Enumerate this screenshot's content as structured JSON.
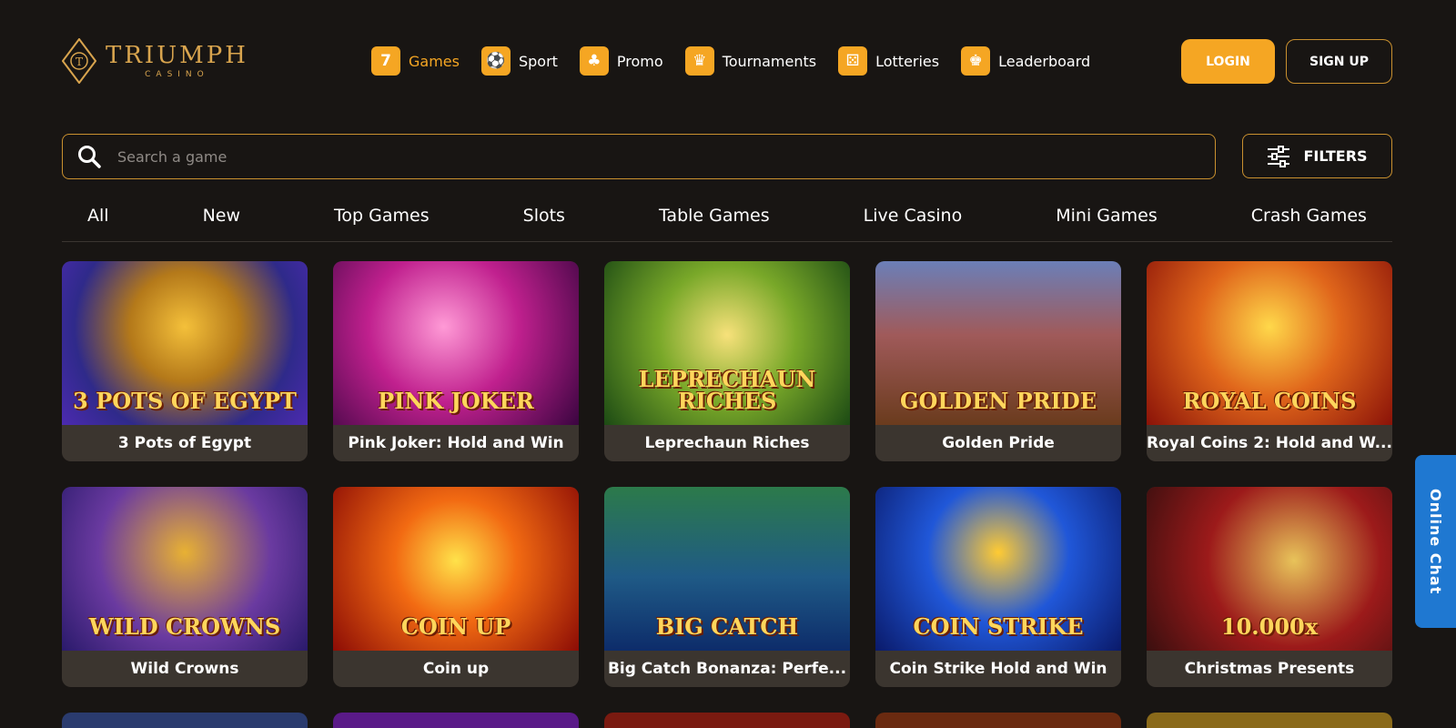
{
  "brand": {
    "name": "TRIUMPH",
    "sub": "CASINO",
    "accent": "#f5a623"
  },
  "nav": [
    {
      "label": "Games",
      "icon": "seven-icon",
      "glyph": "7",
      "active": true
    },
    {
      "label": "Sport",
      "icon": "ball-icon",
      "glyph": "⚽",
      "active": false
    },
    {
      "label": "Promo",
      "icon": "clover-icon",
      "glyph": "♣",
      "active": false
    },
    {
      "label": "Tournaments",
      "icon": "trophy-icon",
      "glyph": "♛",
      "active": false
    },
    {
      "label": "Lotteries",
      "icon": "dice-icon",
      "glyph": "⚄",
      "active": false
    },
    {
      "label": "Leaderboard",
      "icon": "crown-icon",
      "glyph": "♚",
      "active": false
    }
  ],
  "auth": {
    "login": "LOGIN",
    "signup": "SIGN UP"
  },
  "search": {
    "placeholder": "Search a game",
    "value": ""
  },
  "filters": {
    "label": "FILTERS"
  },
  "tabs": [
    "All",
    "New",
    "Top Games",
    "Slots",
    "Table Games",
    "Live Casino",
    "Mini Games",
    "Crash Games"
  ],
  "games": [
    {
      "title": "3 Pots of Egypt",
      "art": "3 POTS OF EGYPT"
    },
    {
      "title": "Pink Joker: Hold and Win",
      "art": "PINK JOKER"
    },
    {
      "title": "Leprechaun Riches",
      "art": "LEPRECHAUN RICHES"
    },
    {
      "title": "Golden Pride",
      "art": "GOLDEN PRIDE"
    },
    {
      "title": "Royal Coins 2: Hold and W...",
      "art": "ROYAL COINS"
    },
    {
      "title": "Wild Crowns",
      "art": "WILD CROWNS"
    },
    {
      "title": "Coin up",
      "art": "COIN UP"
    },
    {
      "title": "Big Catch Bonanza: Perfe...",
      "art": "BIG CATCH"
    },
    {
      "title": "Coin Strike Hold and Win",
      "art": "COIN STRIKE"
    },
    {
      "title": "Christmas Presents",
      "art": "10.000x"
    }
  ],
  "chat": {
    "label": "Online Chat",
    "color": "#1f78d1"
  }
}
